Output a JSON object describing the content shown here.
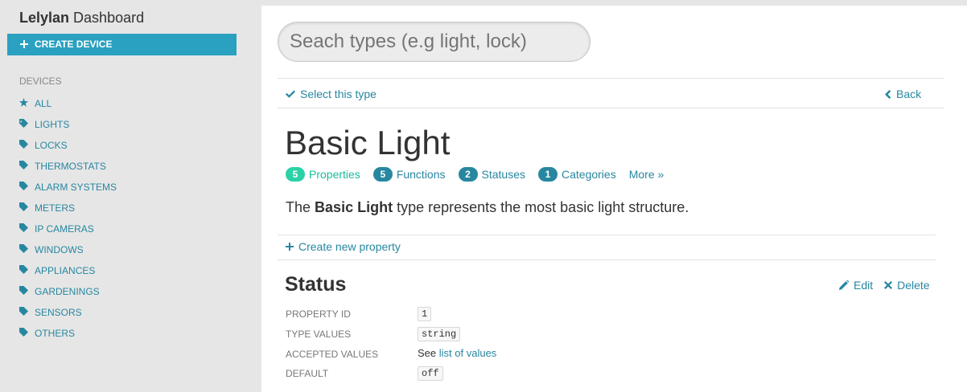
{
  "sidebar": {
    "brand_bold": "Lelylan",
    "brand_rest": "Dashboard",
    "create_button": "CREATE DEVICE",
    "section_title": "DEVICES",
    "items": [
      {
        "label": "ALL",
        "icon": "star-icon"
      },
      {
        "label": "LIGHTS",
        "icon": "tag-icon"
      },
      {
        "label": "LOCKS",
        "icon": "tag-icon"
      },
      {
        "label": "THERMOSTATS",
        "icon": "tag-icon"
      },
      {
        "label": "ALARM SYSTEMS",
        "icon": "tag-icon"
      },
      {
        "label": "METERS",
        "icon": "tag-icon"
      },
      {
        "label": "IP CAMERAS",
        "icon": "tag-icon"
      },
      {
        "label": "WINDOWS",
        "icon": "tag-icon"
      },
      {
        "label": "APPLIANCES",
        "icon": "tag-icon"
      },
      {
        "label": "GARDENINGS",
        "icon": "tag-icon"
      },
      {
        "label": "SENSORS",
        "icon": "tag-icon"
      },
      {
        "label": "OTHERS",
        "icon": "tag-icon"
      }
    ]
  },
  "search": {
    "placeholder": "Seach types (e.g light, lock)"
  },
  "toolbar": {
    "select_label": "Select this type",
    "back_label": "Back"
  },
  "type": {
    "title": "Basic Light",
    "tabs": [
      {
        "count": "5",
        "label": "Properties"
      },
      {
        "count": "5",
        "label": "Functions"
      },
      {
        "count": "2",
        "label": "Statuses"
      },
      {
        "count": "1",
        "label": "Categories"
      }
    ],
    "more_label": "More »",
    "desc_pre": "The",
    "desc_bold": "Basic Light",
    "desc_post": "type represents the most basic light structure.",
    "create_property_label": "Create new property"
  },
  "property": {
    "title": "Status",
    "edit_label": "Edit",
    "delete_label": "Delete",
    "rows": {
      "id_label": "PROPERTY ID",
      "id_value": "1",
      "type_label": "TYPE VALUES",
      "type_value": "string",
      "accepted_label": "ACCEPTED VALUES",
      "accepted_prefix": "See",
      "accepted_link": "list of values",
      "default_label": "DEFAULT",
      "default_value": "off"
    }
  },
  "colors": {
    "accent": "#2aa1c0",
    "link": "#2787a0",
    "active": "#2bd1a7"
  }
}
